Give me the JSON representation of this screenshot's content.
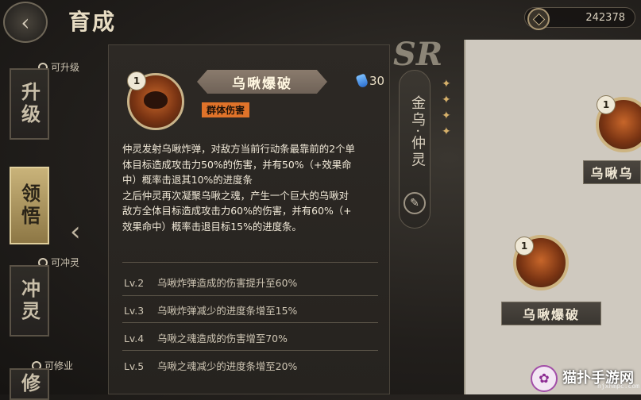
{
  "header": {
    "back_icon": "back-arrow-icon",
    "title": "育成",
    "currency_value": "242378",
    "currency_icon": "coin-icon"
  },
  "nav": {
    "tabs": [
      {
        "label": "升级",
        "hint": "可升级",
        "active": false
      },
      {
        "label": "领悟",
        "hint": "",
        "active": true
      },
      {
        "label": "冲灵",
        "hint": "可冲灵",
        "active": false
      },
      {
        "label": "修",
        "hint": "可修业",
        "active": false
      }
    ]
  },
  "skill": {
    "name": "乌啾爆破",
    "level": "1",
    "tag": "群体伤害",
    "cost": "30",
    "cost_icon": "energy-drop-icon",
    "description_lines": [
      "仲灵发射乌啾炸弹，对敌方当前行动条最靠前的2个单",
      "体目标造成攻击力50%的伤害，并有50%（+效果命",
      "中）概率击退其10%的进度条",
      "之后仲灵再次凝聚乌啾之魂，产生一个巨大的乌啾对",
      "敌方全体目标造成攻击力60%的伤害，并有60%（+",
      "效果命中）概率击退目标15%的进度条。"
    ],
    "upgrades": [
      {
        "level": "Lv.2",
        "text": "乌啾炸弹造成的伤害提升至60%"
      },
      {
        "level": "Lv.3",
        "text": "乌啾炸弹减少的进度条增至15%"
      },
      {
        "level": "Lv.4",
        "text": "乌啾之魂造成的伤害增至70%"
      },
      {
        "level": "Lv.5",
        "text": "乌啾之魂减少的进度条增至20%"
      }
    ]
  },
  "hero": {
    "rarity": "SR",
    "name": "金乌·仲灵"
  },
  "right_panel": {
    "skills": [
      {
        "level": "1",
        "name": "乌啾乌"
      },
      {
        "level": "1",
        "name": "乌啾爆破"
      }
    ]
  },
  "watermark": {
    "text": "猫扑手游网",
    "sub": "njxhmpc.com"
  },
  "colors": {
    "accent": "#e0732a",
    "gold": "#c9b48a",
    "panel": "#2d2925"
  }
}
